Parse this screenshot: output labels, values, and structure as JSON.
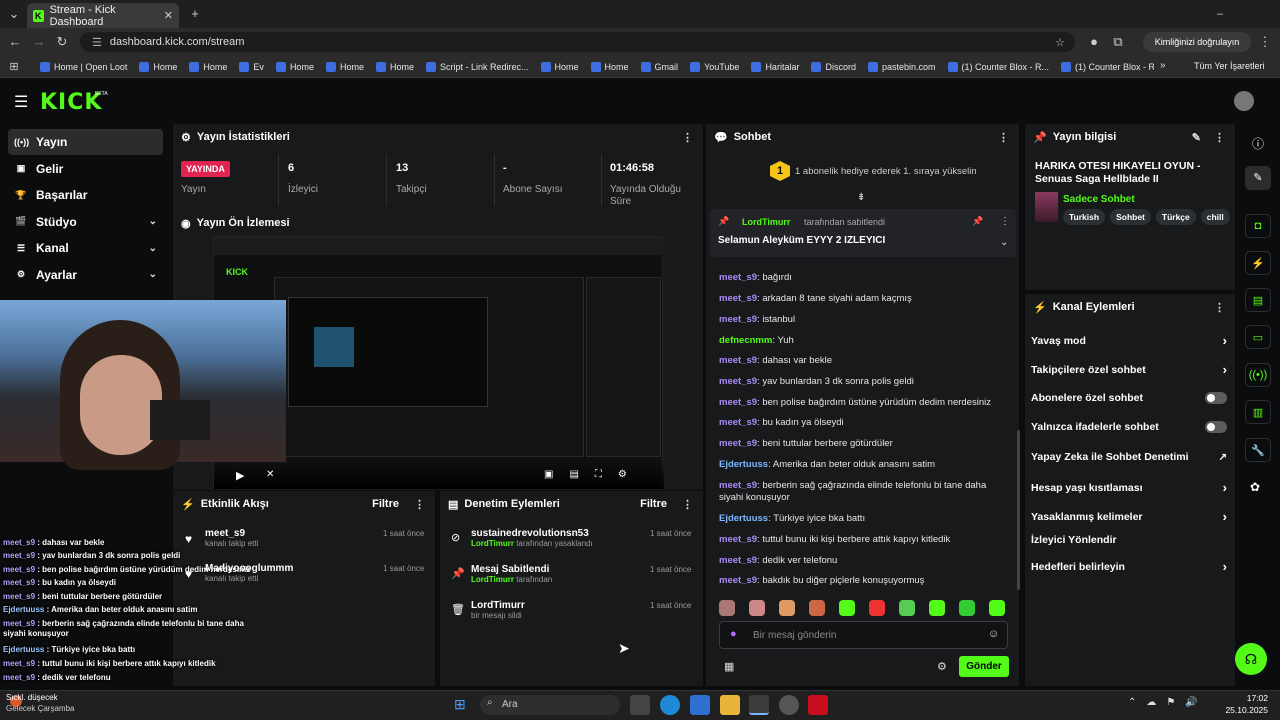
{
  "browser": {
    "tab_title": "Stream - Kick Dashboard",
    "url": "dashboard.kick.com/stream",
    "verify_label": "Kimliğinizi doğrulayın",
    "bookmarks": [
      "Home | Open Loot",
      "Home",
      "Home",
      "Ev",
      "Home",
      "Home",
      "Home",
      "Script - Link Redirec...",
      "Home",
      "Home",
      "Gmail",
      "YouTube",
      "Haritalar",
      "Discord",
      "pastebin.com",
      "(1) Counter Blox - R...",
      "(1) Counter Blox - R..."
    ],
    "all_bookmarks": "Tüm Yer İşaretleri"
  },
  "header": {
    "logo": "KICK",
    "beta": "BETA"
  },
  "sidebar": {
    "items": [
      {
        "label": "Yayın",
        "icon": "broadcast-icon"
      },
      {
        "label": "Gelir",
        "icon": "money-icon"
      },
      {
        "label": "Başarılar",
        "icon": "trophy-icon"
      },
      {
        "label": "Stüdyo",
        "icon": "studio-icon"
      },
      {
        "label": "Kanal",
        "icon": "channel-icon"
      },
      {
        "label": "Ayarlar",
        "icon": "gear-icon"
      }
    ]
  },
  "stats": {
    "title": "Yayın İstatistikleri",
    "live": "YAYINDA",
    "live_label": "Yayın",
    "viewers": "6",
    "viewers_label": "İzleyici",
    "followers": "13",
    "followers_label": "Takipçi",
    "subs": "-",
    "subs_label": "Abone Sayısı",
    "uptime": "01:46:58",
    "uptime_label": "Yayında Olduğu Süre"
  },
  "preview": {
    "title": "Yayın Ön İzlemesi"
  },
  "overlay_chat": [
    {
      "u": "meet_s9",
      "t": "dahası var bekle"
    },
    {
      "u": "meet_s9",
      "t": "yav bunlardan 3 dk sonra polis geldi"
    },
    {
      "u": "meet_s9",
      "t": "ben polise bağırdım üstüne yürüdüm dedim nerdesiniz"
    },
    {
      "u": "meet_s9",
      "t": "bu kadın ya ölseydi"
    },
    {
      "u": "meet_s9",
      "t": "beni tuttular berbere götürdüler"
    },
    {
      "u": "Ejdertuuss",
      "t": "Amerika dan beter olduk anasını satim"
    },
    {
      "u": "meet_s9",
      "t": "berberin sağ çağrazında elinde telefonlu bi tane daha siyahi konuşuyor"
    },
    {
      "u": "Ejdertuuss",
      "t": "Türkiye iyice bka battı"
    },
    {
      "u": "meet_s9",
      "t": "tuttul bunu iki kişi berbere attık kapıyı kitledik"
    },
    {
      "u": "meet_s9",
      "t": "dedik ver telefonu"
    }
  ],
  "activity": {
    "title": "Etkinlik Akışı",
    "filter": "Filtre",
    "items": [
      {
        "name": "meet_s9",
        "sub": "kanalı takip etti",
        "time": "1 saat önce"
      },
      {
        "name": "Madiyoooglummm",
        "sub": "kanalı takip etti",
        "time": "1 saat önce"
      }
    ]
  },
  "moderation": {
    "title": "Denetim Eylemleri",
    "filter": "Filtre",
    "items": [
      {
        "name": "sustainedrevolutionsn53",
        "actor": "LordTimurr",
        "sub": "tarafından yasaklandı",
        "time": "1 saat önce"
      },
      {
        "name": "Mesaj Sabitlendi",
        "actor": "LordTimurr",
        "sub": "tarafından",
        "time": "1 saat önce"
      },
      {
        "name": "LordTimurr",
        "actor": "",
        "sub": "bir mesajı sildi",
        "time": "1 saat önce"
      }
    ]
  },
  "chat": {
    "title": "Sohbet",
    "gift_banner": "1 abonelik hediye ederek 1. sıraya yükselin",
    "gift_rank": "1",
    "pinned_by": "LordTimurr",
    "pinned_by_suffix": "tarafından sabitlendi",
    "pinned_msg": "Selamun Aleyküm EYYY 2 IZLEYICI",
    "input_placeholder": "Bir mesaj gönderin",
    "send": "Gönder",
    "messages": [
      {
        "u": "meet_s9",
        "t": "bağırdı",
        "c": "un"
      },
      {
        "u": "meet_s9",
        "t": "arkadan 8 tane siyahi adam kaçmış",
        "c": "un"
      },
      {
        "u": "meet_s9",
        "t": "istanbul",
        "c": "un"
      },
      {
        "u": "defnecnmm",
        "t": "Yuh",
        "c": "ung"
      },
      {
        "u": "meet_s9",
        "t": "dahası var bekle",
        "c": "un"
      },
      {
        "u": "meet_s9",
        "t": "yav bunlardan 3 dk sonra polis geldi",
        "c": "un"
      },
      {
        "u": "meet_s9",
        "t": "ben polise bağırdım üstüne yürüdüm dedim nerdesiniz",
        "c": "un"
      },
      {
        "u": "meet_s9",
        "t": "bu kadın ya ölseydi",
        "c": "un"
      },
      {
        "u": "meet_s9",
        "t": "beni tuttular berbere götürdüler",
        "c": "un"
      },
      {
        "u": "Ejdertuuss",
        "t": "Amerika dan beter olduk anasını satim",
        "c": "unb"
      },
      {
        "u": "meet_s9",
        "t": "berberin sağ çağrazında elinde telefonlu bi tane daha siyahi konuşuyor",
        "c": "un"
      },
      {
        "u": "Ejdertuuss",
        "t": "Türkiye iyice bka battı",
        "c": "unb"
      },
      {
        "u": "meet_s9",
        "t": "tuttul bunu iki kişi berbere attık kapıyı kitledik",
        "c": "un"
      },
      {
        "u": "meet_s9",
        "t": "dedik ver telefonu",
        "c": "un"
      },
      {
        "u": "meet_s9",
        "t": "bakdık bu diğer piçlerle konuşuyormuş",
        "c": "un"
      }
    ]
  },
  "info": {
    "title": "Yayın bilgisi",
    "stream_title": "HARIKA OTESI HIKAYELI OYUN - Senuas Saga Hellblade II",
    "mode": "Sadece Sohbet",
    "tags": [
      "Turkish",
      "Sohbet",
      "Türkçe",
      "chill"
    ]
  },
  "actions": {
    "title": "Kanal Eylemleri",
    "rows": [
      {
        "label": "Yavaş mod",
        "kind": "chev"
      },
      {
        "label": "Takipçilere özel sohbet",
        "kind": "chev"
      },
      {
        "label": "Abonelere özel sohbet",
        "kind": "toggle"
      },
      {
        "label": "Yalnızca ifadelerle sohbet",
        "kind": "toggle"
      },
      {
        "label": "Yapay Zeka ile Sohbet Denetimi",
        "kind": "ext"
      },
      {
        "label": "Hesap yaşı kısıtlaması",
        "kind": "chev"
      },
      {
        "label": "Yasaklanmış kelimeler",
        "kind": "chev"
      },
      {
        "label": "İzleyici Yönlendir",
        "kind": "none"
      },
      {
        "label": "Hedefleri belirleyin",
        "kind": "chev"
      }
    ]
  },
  "taskbar": {
    "weather_temp": "Sıckl. düşecek",
    "weather_day": "Gelecek Çarşamba",
    "search": "Ara",
    "time": "17:02",
    "date": "25.10.2025"
  },
  "colors": {
    "accent": "#53fc18",
    "live": "#e0244f"
  }
}
